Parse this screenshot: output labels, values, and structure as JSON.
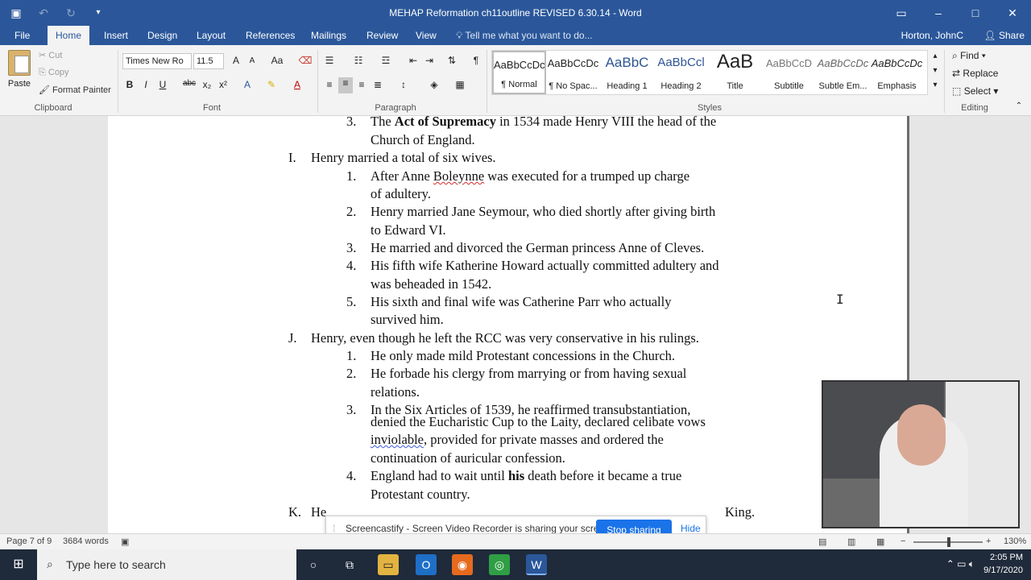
{
  "titlebar": {
    "title": "MEHAP Reformation ch11outline REVISED 6.30.14 - Word",
    "save_icon": "save-icon",
    "undo_icon": "undo-icon",
    "redo_icon": "redo-icon",
    "customize_icon": "customize-icon",
    "win_restore_icon": "ribbon-display-icon",
    "minimize": "–",
    "maximize": "□",
    "close": "✕"
  },
  "tabs": [
    "File",
    "Home",
    "Insert",
    "Design",
    "Layout",
    "References",
    "Mailings",
    "Review",
    "View"
  ],
  "tell_me": "Tell me what you want to do...",
  "user": "Horton, JohnC",
  "share": "Share",
  "clipboard": {
    "paste": "Paste",
    "cut": "Cut",
    "copy": "Copy",
    "format_painter": "Format Painter",
    "label": "Clipboard"
  },
  "font": {
    "family": "Times New Ro",
    "size": "11.5",
    "label": "Font",
    "grow": "A",
    "shrink": "A",
    "case": "Aa",
    "bold": "B",
    "italic": "I",
    "underline": "U",
    "strike": "abc",
    "subscript": "x₂",
    "superscript": "x²"
  },
  "paragraph": {
    "label": "Paragraph"
  },
  "styles": {
    "label": "Styles",
    "items": [
      {
        "preview": "AaBbCcDc",
        "name": "¶ Normal"
      },
      {
        "preview": "AaBbCcDc",
        "name": "¶ No Spac..."
      },
      {
        "preview": "AaBbC",
        "name": "Heading 1"
      },
      {
        "preview": "AaBbCcl",
        "name": "Heading 2"
      },
      {
        "preview": "AaB",
        "name": "Title"
      },
      {
        "preview": "AaBbCcD",
        "name": "Subtitle"
      },
      {
        "preview": "AaBbCcDc",
        "name": "Subtle Em..."
      },
      {
        "preview": "AaBbCcDc",
        "name": "Emphasis"
      }
    ]
  },
  "editing": {
    "find": "Find",
    "replace": "Replace",
    "select": "Select",
    "label": "Editing"
  },
  "document": {
    "lines": [
      {
        "num": "3.",
        "parts": [
          {
            "t": "The "
          },
          {
            "t": "Act of Supremacy",
            "b": true
          },
          {
            "t": " in 1534 made Henry VIII the head of the"
          }
        ]
      },
      {
        "cont": "Church of England."
      },
      {
        "letter": "I.",
        "text": "Henry married a total of six wives."
      },
      {
        "num": "1.",
        "parts": [
          {
            "t": "After Anne "
          },
          {
            "t": "Boleynne",
            "sq": true
          },
          {
            "t": " was executed for a trumped up charge"
          }
        ]
      },
      {
        "cont": "of adultery."
      },
      {
        "num": "2.",
        "text": "Henry married Jane Seymour, who died shortly after giving birth"
      },
      {
        "cont": "to Edward VI."
      },
      {
        "num": "3.",
        "text": "He married and divorced the German princess Anne of Cleves."
      },
      {
        "num": "4.",
        "text": "His fifth wife Katherine Howard actually committed adultery and"
      },
      {
        "cont": "was beheaded in 1542."
      },
      {
        "num": "5.",
        "text": "His sixth and final wife was Catherine Parr who actually"
      },
      {
        "cont": "survived him."
      },
      {
        "letter": "J.",
        "text": "Henry, even though he left the RCC was very conservative in his rulings."
      },
      {
        "num": "1.",
        "text": "He only made mild Protestant concessions in the Church."
      },
      {
        "num": "2.",
        "text": "He forbade his clergy from marrying or from having sexual"
      },
      {
        "cont": "relations."
      },
      {
        "num": "3.",
        "text": "In the Six Articles of 1539, he reaffirmed transubstantiation,"
      },
      {
        "cont": "denied the Eucharistic Cup to the Laity, declared celibate vows"
      },
      {
        "cont_parts": [
          {
            "t": "inviolable",
            "sqb": true
          },
          {
            "t": ", provided for private masses and ordered the"
          }
        ]
      },
      {
        "cont": "continuation of auricular confession."
      },
      {
        "num": "4.",
        "parts": [
          {
            "t": "England had to wait until "
          },
          {
            "t": "his",
            "b": true
          },
          {
            "t": " death before it became a true"
          }
        ]
      },
      {
        "cont": "Protestant country."
      },
      {
        "letter": "K.",
        "text": "He",
        "tail": "King."
      }
    ]
  },
  "share_bar": {
    "message": "Screencastify - Screen Video Recorder is sharing your screen.",
    "stop": "Stop sharing",
    "hide": "Hide"
  },
  "status": {
    "page": "Page 7 of 9",
    "words": "3684 words",
    "zoom": "130%"
  },
  "taskbar": {
    "search_placeholder": "Type here to search",
    "time": "2:05 PM",
    "date": "9/17/2020"
  }
}
